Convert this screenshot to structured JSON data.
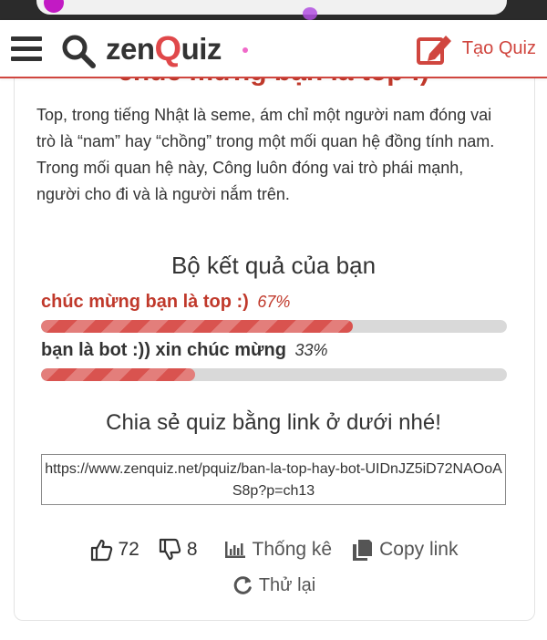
{
  "header": {
    "logo_prefix": "zen",
    "logo_q": "Q",
    "logo_suffix": "uiz",
    "create_quiz_label": "Tạo Quiz"
  },
  "result_heading": "chúc mừng bạn là top :)",
  "description": "Top, trong tiếng Nhật là seme, ám chỉ một người nam đóng vai trò là “nam” hay “chồng” trong một mối quan hệ đồng tính nam. Trong mối quan hệ này, Công luôn đóng vai trò phái mạnh, người cho đi và là người nắm trên.",
  "results": {
    "title": "Bộ kết quả của bạn",
    "items": [
      {
        "label": "chúc mừng bạn là top :)",
        "percent_label": "67%",
        "percent": 67
      },
      {
        "label": "bạn là bot :)) xin chúc mừng",
        "percent_label": "33%",
        "percent": 33
      }
    ]
  },
  "share": {
    "title": "Chia sẻ quiz bằng link ở dưới nhé!",
    "link": "https://www.zenquiz.net/pquiz/ban-la-top-hay-bot-UIDnJZ5iD72NAOoAS8p?p=ch13"
  },
  "actions": {
    "likes": "72",
    "dislikes": "8",
    "stats_label": "Thống kê",
    "copy_label": "Copy link",
    "retry_label": "Thử lại"
  },
  "colors": {
    "accent": "#d0463f",
    "bar_fill": "#d9534f",
    "bar_track": "#d9d9d9"
  },
  "icons": [
    "menu-icon",
    "search-icon",
    "edit-icon",
    "thumbs-up-icon",
    "thumbs-down-icon",
    "bar-chart-icon",
    "copy-icon",
    "refresh-icon"
  ]
}
